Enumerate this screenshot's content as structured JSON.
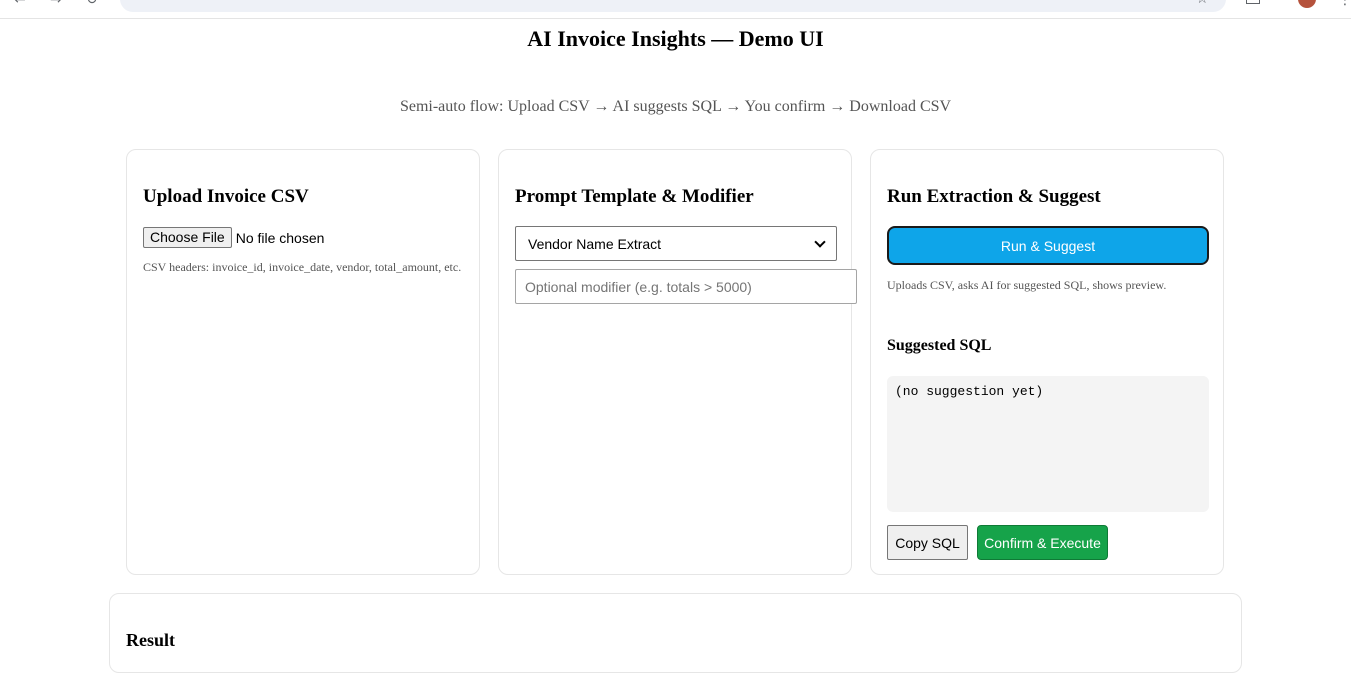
{
  "page": {
    "title": "AI Invoice Insights — Demo UI",
    "subtitle": "Semi-auto flow: Upload CSV → AI suggests SQL → You confirm → Download CSV"
  },
  "upload": {
    "heading": "Upload Invoice CSV",
    "choose_label": "Choose File",
    "file_status": "No file chosen",
    "hint": "CSV headers: invoice_id, invoice_date, vendor, total_amount, etc."
  },
  "prompt": {
    "heading": "Prompt Template & Modifier",
    "selected_template": "Vendor Name Extract",
    "modifier_placeholder": "Optional modifier (e.g. totals > 5000)"
  },
  "run": {
    "heading": "Run Extraction & Suggest",
    "run_label": "Run & Suggest",
    "hint": "Uploads CSV, asks AI for suggested SQL, shows preview.",
    "sql_heading": "Suggested SQL",
    "sql_text": "(no suggestion yet)",
    "copy_label": "Copy SQL",
    "execute_label": "Confirm & Execute"
  },
  "result": {
    "heading": "Result"
  },
  "colors": {
    "run_button": "#0ea5e9",
    "execute_button": "#16a34a"
  }
}
